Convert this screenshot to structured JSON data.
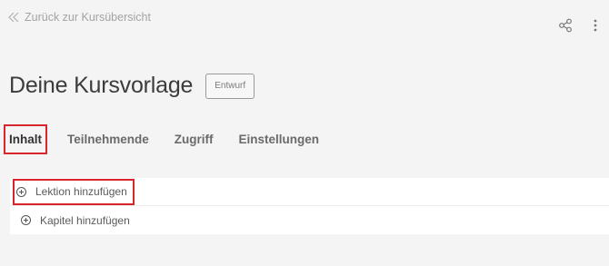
{
  "header": {
    "back_label": "Zurück zur Kursübersicht",
    "back_icon": "double-chevron-left-icon",
    "actions": [
      {
        "name": "share",
        "icon": "share-icon"
      },
      {
        "name": "more",
        "icon": "more-vertical-icon"
      }
    ]
  },
  "course": {
    "title": "Deine Kursvorlage",
    "status": "Entwurf"
  },
  "tabs": [
    {
      "label": "Inhalt",
      "active": true
    },
    {
      "label": "Teilnehmende",
      "active": false
    },
    {
      "label": "Zugriff",
      "active": false
    },
    {
      "label": "Einstellungen",
      "active": false
    }
  ],
  "content": {
    "add_lesson_label": "Lektion hinzufügen",
    "add_chapter_label": "Kapitel hinzufügen",
    "add_icon": "plus-circle-icon"
  },
  "colors": {
    "background": "#f4f4f4",
    "highlight": "#d9262c",
    "panel": "#ffffff"
  }
}
